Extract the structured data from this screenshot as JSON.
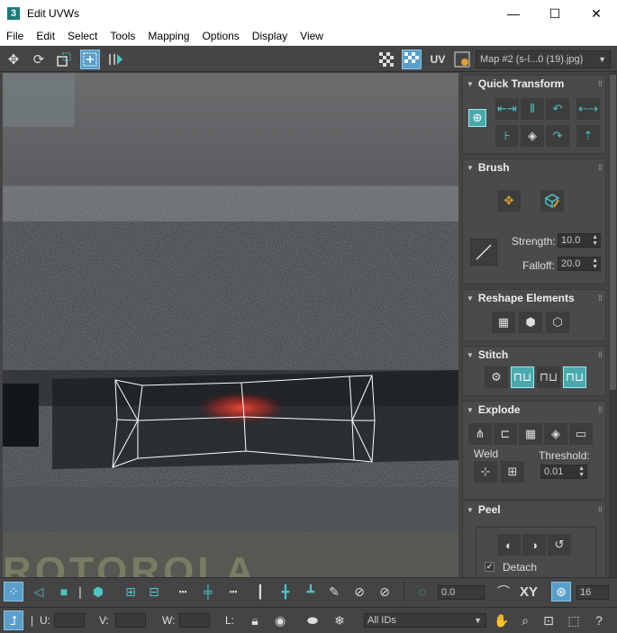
{
  "window": {
    "app_icon_glyph": "3",
    "title": "Edit UVWs",
    "minimize": "—",
    "maximize": "☐",
    "close": "✕"
  },
  "menu": [
    "File",
    "Edit",
    "Select",
    "Tools",
    "Mapping",
    "Options",
    "Display",
    "View"
  ],
  "top_toolbar": {
    "uv_label": "UV",
    "map_dropdown": "Map #2 (s-l...0 (19).jpg)"
  },
  "panel": {
    "quick_transform": {
      "title": "Quick Transform"
    },
    "brush": {
      "title": "Brush",
      "strength_label": "Strength:",
      "strength_value": "10.0",
      "falloff_label": "Falloff:",
      "falloff_value": "20.0"
    },
    "reshape": {
      "title": "Reshape Elements"
    },
    "stitch": {
      "title": "Stitch"
    },
    "explode": {
      "title": "Explode",
      "weld_label": "Weld",
      "threshold_label": "Threshold:",
      "threshold_value": "0.01"
    },
    "peel": {
      "title": "Peel",
      "detach_label": "Detach",
      "detach_checked": true
    }
  },
  "bottom_toolbar": {
    "value_field": "0.0",
    "xy_label": "XY",
    "count_field": "16",
    "u_label": "U:",
    "v_label": "V:",
    "w_label": "W:",
    "l_label": "L:",
    "ids_dropdown": "All IDs"
  },
  "colors": {
    "accent_teal": "#4fc3c8",
    "active_blue": "#5a9ec9",
    "panel_bg": "#444444"
  }
}
